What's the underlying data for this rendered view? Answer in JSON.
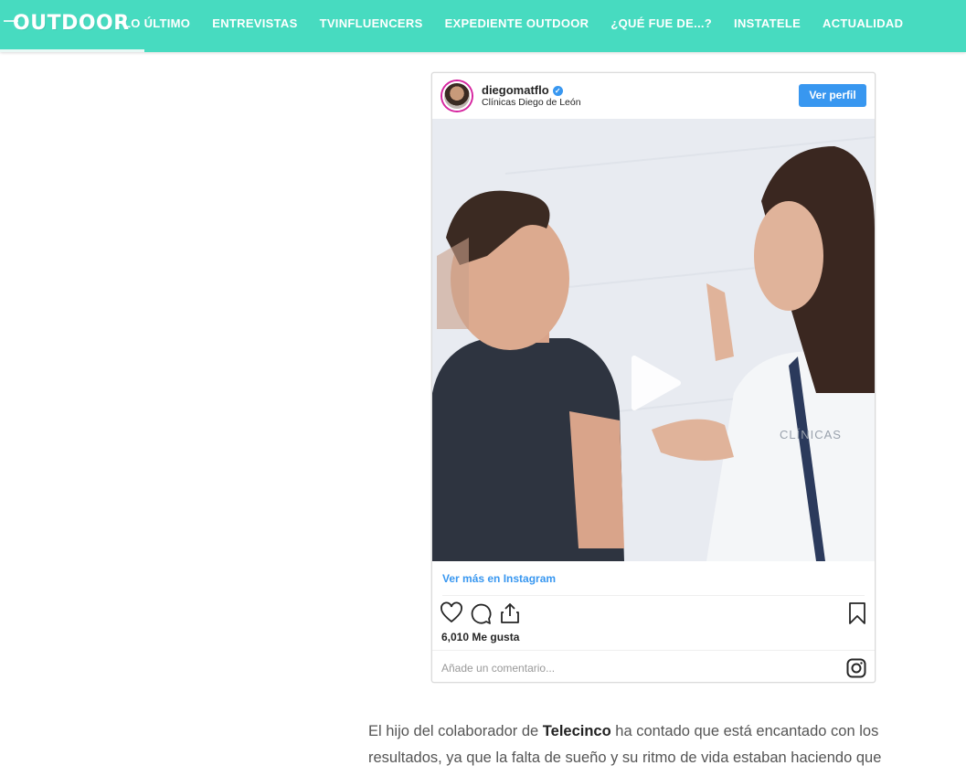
{
  "header": {
    "logo": "OUTDOOR",
    "nav": [
      "LO ÚLTIMO",
      "ENTREVISTAS",
      "TVINFLUENCERS",
      "EXPEDIENTE OUTDOOR",
      "¿QUÉ FUE DE...?",
      "INSTATELE",
      "ACTUALIDAD"
    ]
  },
  "embed": {
    "username": "diegomatflo",
    "location": "Clínicas Diego de León",
    "profile_button": "Ver perfil",
    "more_link": "Ver más en Instagram",
    "likes": "6,010 Me gusta",
    "comment_placeholder": "Añade un comentario...",
    "media_text": "CLÍNICAS"
  },
  "article": {
    "p1_start": "El hijo del colaborador de ",
    "p1_bold": "Telecinco",
    "p1_end": " ha contado que está encantado con los resultados, ya que la falta de sueño y su ritmo de vida estaban haciendo que"
  },
  "colors": {
    "brand": "#47dbc0",
    "ig_blue": "#3897f0"
  }
}
